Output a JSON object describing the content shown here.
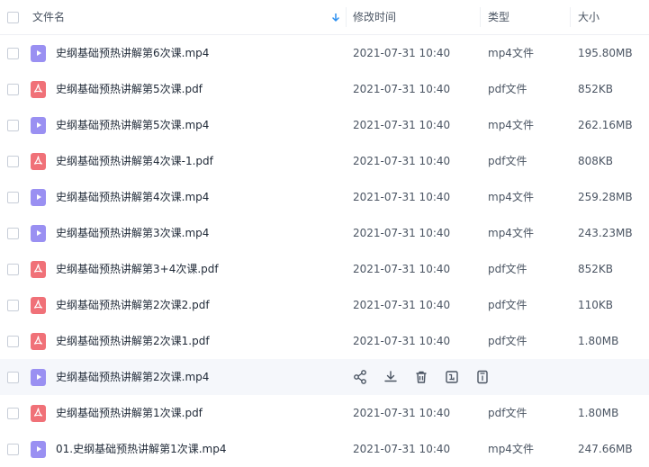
{
  "header": {
    "name": "文件名",
    "modified": "修改时间",
    "type": "类型",
    "size": "大小"
  },
  "files": [
    {
      "name": "史纲基础预热讲解第6次课.mp4",
      "modified": "2021-07-31 10:40",
      "type": "mp4文件",
      "size": "195.80MB",
      "icon": "video-file-icon"
    },
    {
      "name": "史纲基础预热讲解第5次课.pdf",
      "modified": "2021-07-31 10:40",
      "type": "pdf文件",
      "size": "852KB",
      "icon": "pdf-file-icon"
    },
    {
      "name": "史纲基础预热讲解第5次课.mp4",
      "modified": "2021-07-31 10:40",
      "type": "mp4文件",
      "size": "262.16MB",
      "icon": "video-file-icon"
    },
    {
      "name": "史纲基础预热讲解第4次课-1.pdf",
      "modified": "2021-07-31 10:40",
      "type": "pdf文件",
      "size": "808KB",
      "icon": "pdf-file-icon"
    },
    {
      "name": "史纲基础预热讲解第4次课.mp4",
      "modified": "2021-07-31 10:40",
      "type": "mp4文件",
      "size": "259.28MB",
      "icon": "video-file-icon"
    },
    {
      "name": "史纲基础预热讲解第3次课.mp4",
      "modified": "2021-07-31 10:40",
      "type": "mp4文件",
      "size": "243.23MB",
      "icon": "video-file-icon"
    },
    {
      "name": "史纲基础预热讲解第3+4次课.pdf",
      "modified": "2021-07-31 10:40",
      "type": "pdf文件",
      "size": "852KB",
      "icon": "pdf-file-icon"
    },
    {
      "name": "史纲基础预热讲解第2次课2.pdf",
      "modified": "2021-07-31 10:40",
      "type": "pdf文件",
      "size": "110KB",
      "icon": "pdf-file-icon"
    },
    {
      "name": "史纲基础预热讲解第2次课1.pdf",
      "modified": "2021-07-31 10:40",
      "type": "pdf文件",
      "size": "1.80MB",
      "icon": "pdf-file-icon"
    },
    {
      "name": "史纲基础预热讲解第2次课.mp4",
      "modified": "",
      "type": "",
      "size": "",
      "icon": "video-file-icon"
    },
    {
      "name": "史纲基础预热讲解第1次课.pdf",
      "modified": "2021-07-31 10:40",
      "type": "pdf文件",
      "size": "1.80MB",
      "icon": "pdf-file-icon"
    },
    {
      "name": "01.史纲基础预热讲解第1次课.mp4",
      "modified": "2021-07-31 10:40",
      "type": "mp4文件",
      "size": "247.66MB",
      "icon": "video-file-icon"
    }
  ],
  "hover_actions": [
    "share-icon",
    "download-icon",
    "delete-icon",
    "rename-icon",
    "more-icon"
  ],
  "colors": {
    "accent": "#2b8ff0",
    "video_icon": "#9a90f2",
    "pdf_icon": "#f07178",
    "hover_row": "#f5f7fb"
  }
}
